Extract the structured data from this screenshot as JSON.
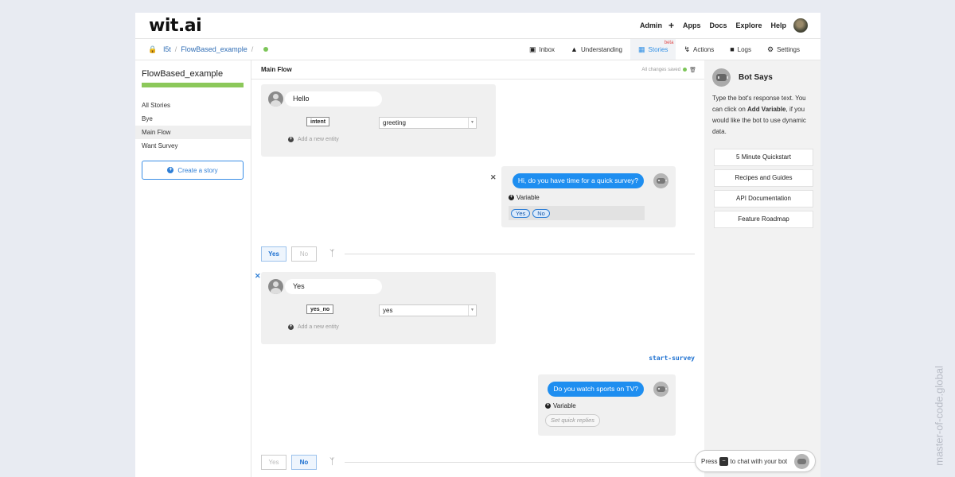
{
  "header": {
    "logo": "wit.ai",
    "nav": [
      "Admin",
      "Apps",
      "Docs",
      "Explore",
      "Help"
    ],
    "plus": "+"
  },
  "breadcrumb": {
    "app": "l5t",
    "story": "FlowBased_example",
    "separator": "/"
  },
  "tabs": [
    {
      "label": "Inbox",
      "icon": "inbox-icon"
    },
    {
      "label": "Understanding",
      "icon": "graduation-cap-icon"
    },
    {
      "label": "Stories",
      "icon": "image-icon",
      "badge": "beta",
      "active": true
    },
    {
      "label": "Actions",
      "icon": "bolt-icon"
    },
    {
      "label": "Logs",
      "icon": "terminal-icon"
    },
    {
      "label": "Settings",
      "icon": "gear-icon"
    }
  ],
  "sidebar": {
    "title": "FlowBased_example",
    "items": [
      "All Stories",
      "Bye",
      "Main Flow",
      "Want Survey"
    ],
    "selected": "Main Flow",
    "create_label": "Create a story"
  },
  "flow": {
    "title": "Main Flow",
    "saved_label": "All changes saved",
    "user1": {
      "text": "Hello",
      "entity": "intent",
      "value": "greeting",
      "add_entity": "Add a new entity"
    },
    "bot1": {
      "text": "Hi, do you have time for a quick survey?",
      "variable": "Variable",
      "quick_replies": [
        "Yes",
        "No"
      ]
    },
    "branch1": {
      "yes": "Yes",
      "no": "No"
    },
    "user2": {
      "text": "Yes",
      "entity": "yes_no",
      "value": "yes",
      "add_entity": "Add a new entity"
    },
    "action": "start-survey",
    "bot2": {
      "text": "Do you watch sports on TV?",
      "variable": "Variable",
      "set_replies": "Set quick replies"
    },
    "branch2": {
      "yes": "Yes",
      "no": "No"
    }
  },
  "right_panel": {
    "title": "Bot Says",
    "desc_1": "Type the bot's response text. You can click on ",
    "desc_bold": "Add Variable",
    "desc_2": ", if you would like the bot to use dynamic data.",
    "links": [
      "5 Minute Quickstart",
      "Recipes and Guides",
      "API Documentation",
      "Feature Roadmap"
    ]
  },
  "chat": {
    "prefix": "Press",
    "key": "~",
    "suffix": "to chat with your bot"
  },
  "watermark": "master-of-code.global",
  "colors": {
    "accent": "#1e8ef0",
    "success": "#7cc558",
    "link": "#2f6db5"
  }
}
